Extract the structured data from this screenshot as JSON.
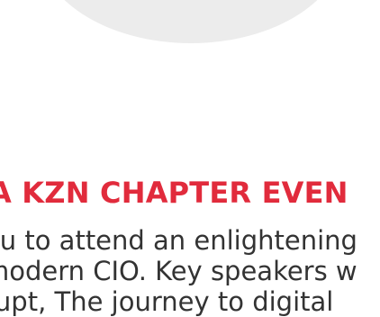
{
  "heading": "A KZN CHAPTER EVEN",
  "paragraph_lines": [
    "ou to attend an enlightening",
    "modern CIO. Key speakers w",
    "rupt, The journey to digital"
  ]
}
